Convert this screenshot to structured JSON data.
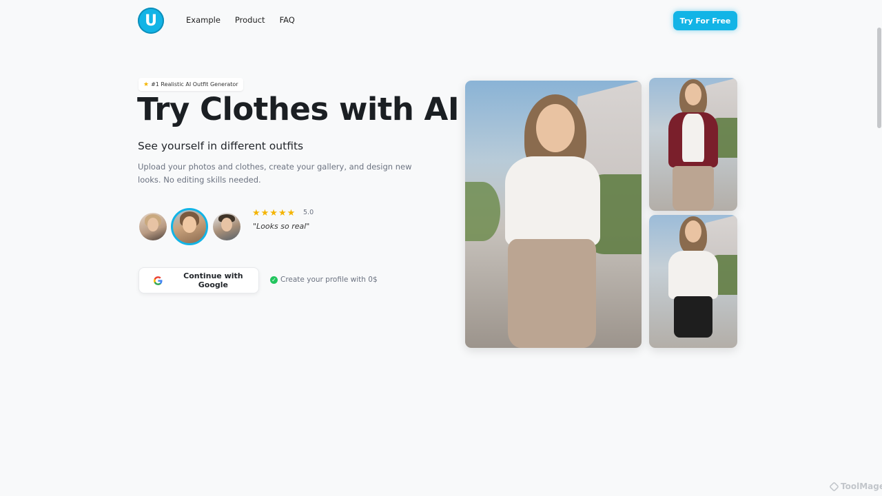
{
  "header": {
    "logo_letter": "U",
    "nav": [
      "Example",
      "Product",
      "FAQ"
    ],
    "cta_label": "Try For Free"
  },
  "hero": {
    "badge": "#1 Realistic AI Outfit Generator",
    "title": "Try Clothes with AI",
    "subtitle": "See yourself in different outfits",
    "description": "Upload your photos and clothes, create your gallery, and design new looks. No editing skills needed."
  },
  "social_proof": {
    "stars": "★★★★★",
    "rating": "5.0",
    "quote": "\"Looks so real\""
  },
  "signup": {
    "google_label": "Continue with Google",
    "free_note": "Create your profile with 0$"
  },
  "watermark": "ToolMage",
  "colors": {
    "accent": "#12b4e6",
    "star": "#f4b400",
    "check": "#22c55e"
  }
}
